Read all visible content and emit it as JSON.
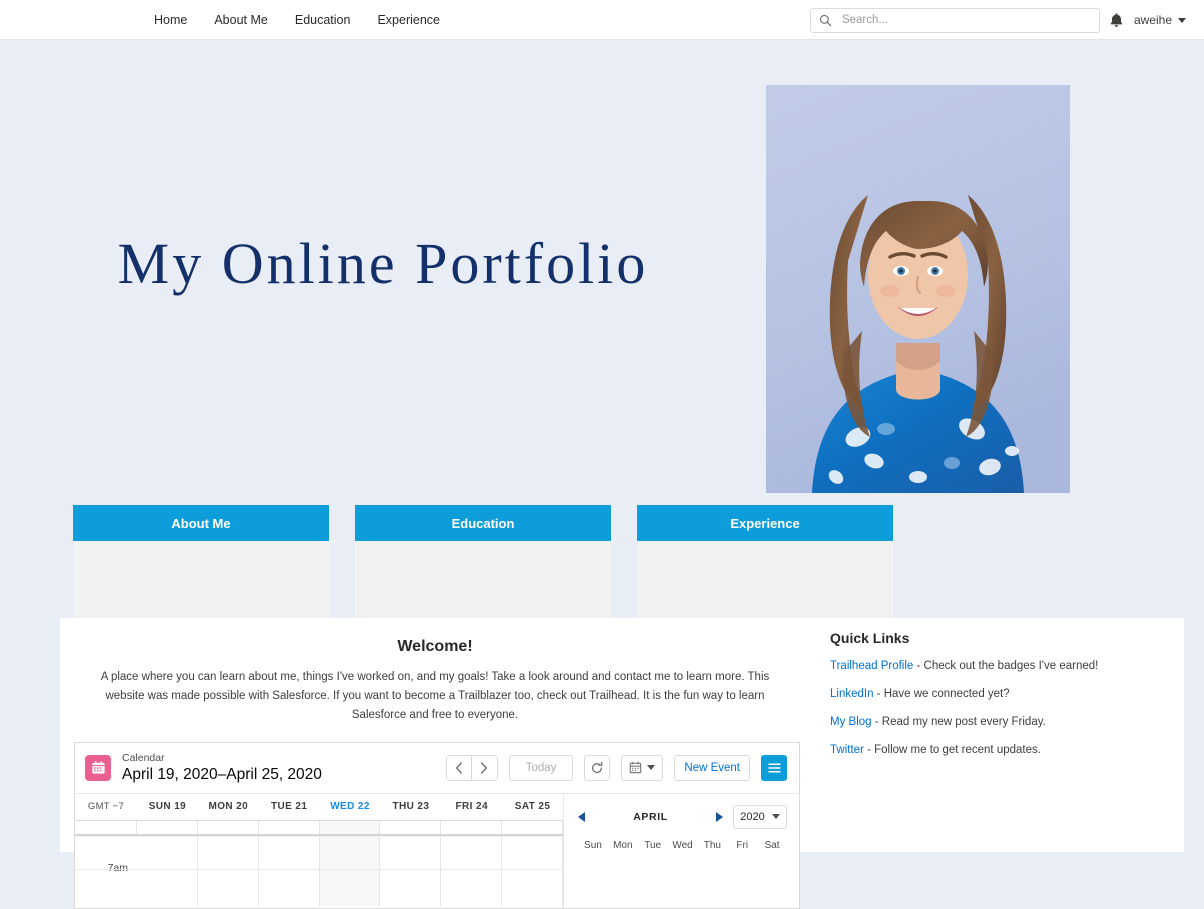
{
  "topbar": {
    "nav_items": [
      {
        "label": "Home"
      },
      {
        "label": "About Me"
      },
      {
        "label": "Education"
      },
      {
        "label": "Experience"
      }
    ],
    "search": {
      "placeholder": "Search...",
      "value": ""
    },
    "notifications_icon": "bell-icon",
    "user": {
      "name": "aweihe"
    }
  },
  "hero": {
    "title": "My Online Portfolio",
    "photo_alt": "portrait-photo"
  },
  "cards": [
    {
      "title": "About Me"
    },
    {
      "title": "Education"
    },
    {
      "title": "Experience"
    }
  ],
  "welcome": {
    "heading": "Welcome!",
    "body": "A place where you can learn about me, things I've worked on, and my goals! Take a look around and contact me to learn more. This website was made possible with Salesforce. If you want to become a Trailblazer too, check out Trailhead. It is the fun way to learn Salesforce and free to everyone."
  },
  "quick_links": {
    "title": "Quick Links",
    "items": [
      {
        "link": "Trailhead Profile",
        "rest": " - Check out the badges I've earned!"
      },
      {
        "link": "LinkedIn",
        "rest": " - Have we connected yet?"
      },
      {
        "link": "My Blog",
        "rest": " - Read my new post every Friday."
      },
      {
        "link": "Twitter",
        "rest": " - Follow me to get recent updates."
      }
    ]
  },
  "calendar": {
    "kicker": "Calendar",
    "range": "April 19, 2020–April 25, 2020",
    "buttons": {
      "prev": "‹",
      "next": "›",
      "today": "Today",
      "refresh": "refresh-icon",
      "view": "calendar-view-icon",
      "new_event": "New Event",
      "menu": "hamburger-icon"
    },
    "timezone": "GMT −7",
    "days": [
      {
        "label": "SUN 19",
        "today": false
      },
      {
        "label": "MON 20",
        "today": false
      },
      {
        "label": "TUE 21",
        "today": false
      },
      {
        "label": "WED 22",
        "today": true
      },
      {
        "label": "THU 23",
        "today": false
      },
      {
        "label": "FRI 24",
        "today": false
      },
      {
        "label": "SAT 25",
        "today": false
      }
    ],
    "hour_label": "7am",
    "mini": {
      "month": "APRIL",
      "year": "2020",
      "dows": [
        "Sun",
        "Mon",
        "Tue",
        "Wed",
        "Thu",
        "Fri",
        "Sat"
      ]
    }
  },
  "colors": {
    "page_background": "#e9edf5",
    "card_header": "#0d9dda",
    "card_body": "#f2f2f2",
    "title_navy": "#13306b",
    "link_blue": "#0070d2",
    "calendar_icon": "#ea6191"
  }
}
